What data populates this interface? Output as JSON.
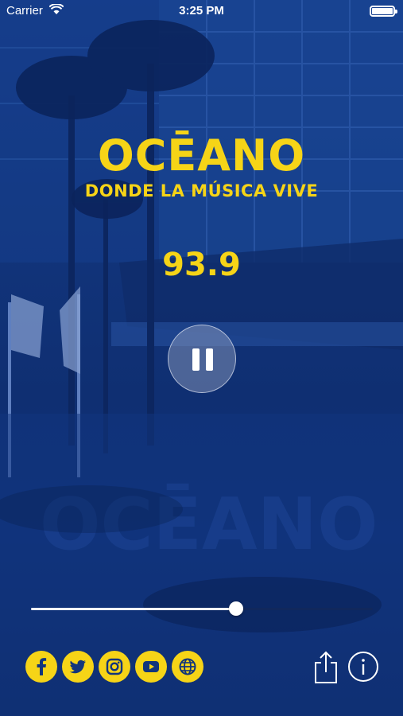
{
  "status_bar": {
    "carrier": "Carrier",
    "time": "3:25 PM",
    "battery_level": 1.0
  },
  "logo": {
    "brand": "OCĒANO",
    "tagline": "DONDE LA MÚSICA VIVE"
  },
  "player": {
    "frequency": "93.9",
    "state": "playing",
    "volume": 0.6
  },
  "social": [
    {
      "name": "facebook-icon"
    },
    {
      "name": "twitter-icon"
    },
    {
      "name": "instagram-icon"
    },
    {
      "name": "youtube-icon"
    },
    {
      "name": "globe-icon"
    }
  ],
  "colors": {
    "accent": "#f6d417",
    "background": "#12357c"
  }
}
